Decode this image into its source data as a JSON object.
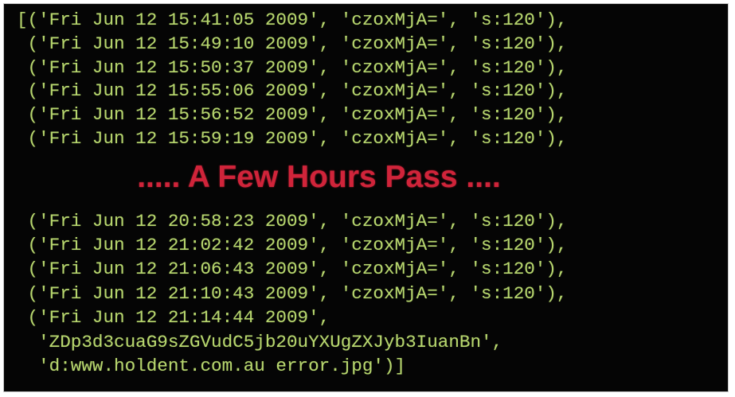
{
  "terminal": {
    "lines_before": [
      "[('Fri Jun 12 15:41:05 2009', 'czoxMjA=', 's:120'),",
      " ('Fri Jun 12 15:49:10 2009', 'czoxMjA=', 's:120'),",
      " ('Fri Jun 12 15:50:37 2009', 'czoxMjA=', 's:120'),",
      " ('Fri Jun 12 15:55:06 2009', 'czoxMjA=', 's:120'),",
      " ('Fri Jun 12 15:56:52 2009', 'czoxMjA=', 's:120'),",
      " ('Fri Jun 12 15:59:19 2009', 'czoxMjA=', 's:120'),"
    ],
    "banner": "..... A Few Hours Pass ....",
    "lines_after": [
      " ('Fri Jun 12 20:58:23 2009', 'czoxMjA=', 's:120'),",
      " ('Fri Jun 12 21:02:42 2009', 'czoxMjA=', 's:120'),",
      " ('Fri Jun 12 21:06:43 2009', 'czoxMjA=', 's:120'),",
      " ('Fri Jun 12 21:10:43 2009', 'czoxMjA=', 's:120'),",
      " ('Fri Jun 12 21:14:44 2009',",
      "  'ZDp3d3cuaG9sZGVudC5jb20uYXUgZXJyb3IuanBn',",
      "  'd:www.holdent.com.au error.jpg')]"
    ]
  },
  "colors": {
    "background": "#050505",
    "code_text": "#b7d66e",
    "banner_text": "#d0243a"
  }
}
